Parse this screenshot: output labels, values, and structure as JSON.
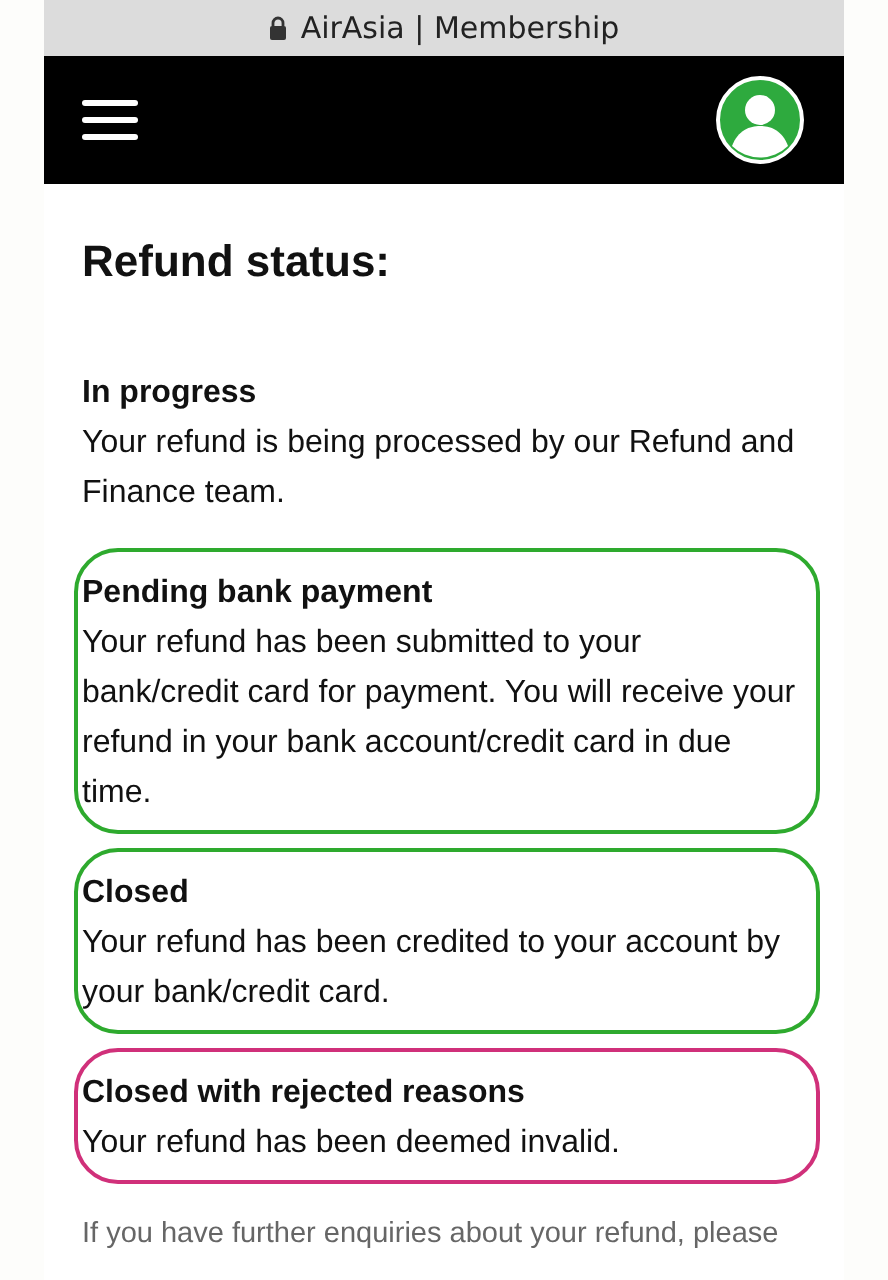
{
  "address_bar": {
    "title": "AirAsia | Membership"
  },
  "page": {
    "title": "Refund status:",
    "statuses": [
      {
        "name": "In progress",
        "description": "Your refund is being processed by our Refund and Finance team."
      },
      {
        "name": "Pending bank payment",
        "description": "Your refund has been submitted to your bank/credit card for payment. You will receive your refund in your bank account/credit card in due time.",
        "color": "#2eaa2e"
      },
      {
        "name": "Closed",
        "description": "Your refund has been credited to your account by your bank/credit card.",
        "color": "#2eaa2e"
      },
      {
        "name": "Closed with rejected reasons",
        "description": "Your refund has been deemed invalid.",
        "color": "#d0307a"
      }
    ],
    "footer_note": "If you have further enquiries about your refund, please"
  }
}
